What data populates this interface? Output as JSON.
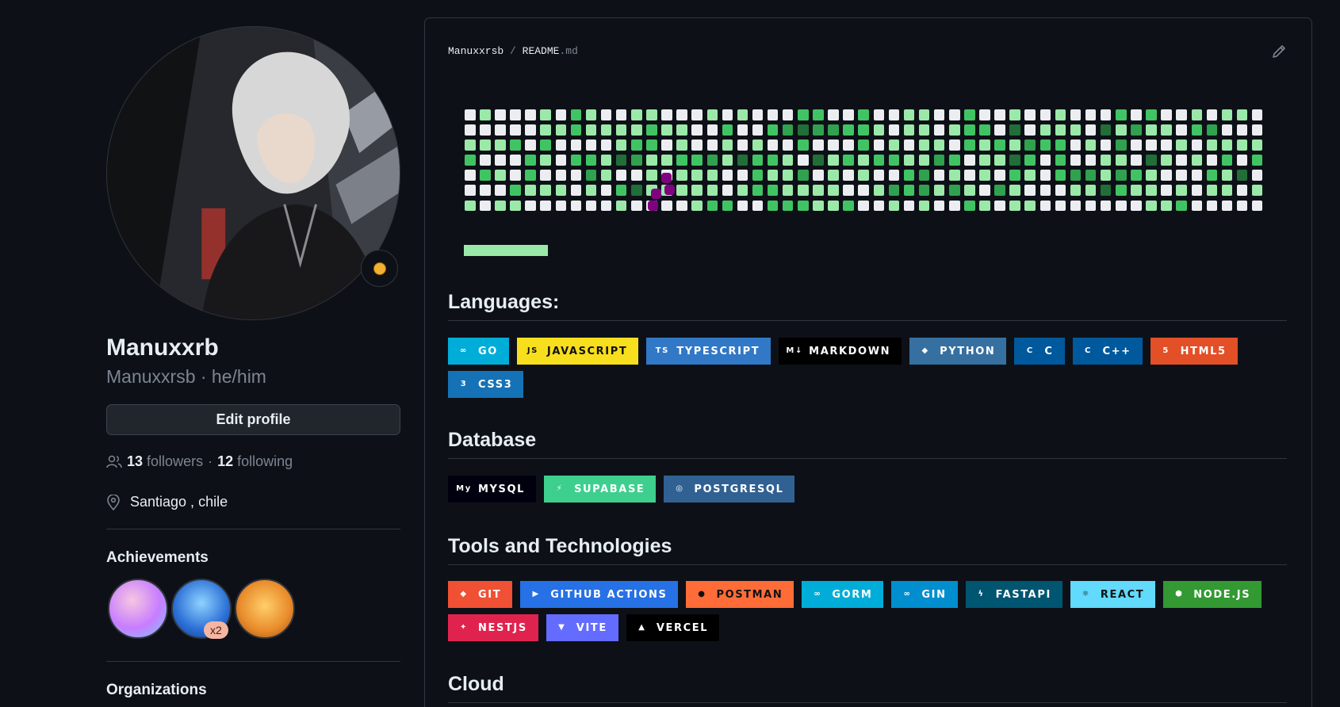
{
  "profile": {
    "name": "Manuxxrb",
    "subtitle": "Manuxxrsb · he/him",
    "edit_label": "Edit profile",
    "followers_count": "13",
    "followers_label": "followers",
    "following_sep": "·",
    "following_count": "12",
    "following_label": "following",
    "location": "Santiago , chile"
  },
  "sections": {
    "achievements": "Achievements",
    "achievement_count": "x2",
    "organizations": "Organizations"
  },
  "readme": {
    "owner": "Manuxxrsb",
    "sep": "/",
    "file_base": "README",
    "file_ext": ".md"
  },
  "headings": {
    "languages": "Languages:",
    "database": "Database",
    "tools": "Tools and Technologies",
    "cloud": "Cloud"
  },
  "languages": [
    {
      "label": "GO",
      "color": "#00add8",
      "icon": "go-icon",
      "glyph": "∞",
      "dark": false
    },
    {
      "label": "JAVASCRIPT",
      "color": "#f7df1e",
      "icon": "javascript-icon",
      "glyph": "JS",
      "dark": true
    },
    {
      "label": "TYPESCRIPT",
      "color": "#3178c6",
      "icon": "typescript-icon",
      "glyph": "TS",
      "dark": false
    },
    {
      "label": "MARKDOWN",
      "color": "#000000",
      "icon": "markdown-icon",
      "glyph": "M↓",
      "dark": false
    },
    {
      "label": "PYTHON",
      "color": "#3670a0",
      "icon": "python-icon",
      "glyph": "◆",
      "dark": false
    },
    {
      "label": "C",
      "color": "#00599c",
      "icon": "c-icon",
      "glyph": "C",
      "dark": false
    },
    {
      "label": "C++",
      "color": "#00599c",
      "icon": "cplusplus-icon",
      "glyph": "C",
      "dark": false
    },
    {
      "label": "HTML5",
      "color": "#e34f26",
      "icon": "html5-icon",
      "glyph": "5",
      "dark": false
    },
    {
      "label": "CSS3",
      "color": "#1572b6",
      "icon": "css3-icon",
      "glyph": "3",
      "dark": false
    }
  ],
  "database": [
    {
      "label": "MYSQL",
      "color": "#00000f",
      "icon": "mysql-icon",
      "glyph": "My",
      "dark": false
    },
    {
      "label": "SUPABASE",
      "color": "#3ecf8e",
      "icon": "supabase-icon",
      "glyph": "⚡",
      "dark": false
    },
    {
      "label": "POSTGRESQL",
      "color": "#316192",
      "icon": "postgresql-icon",
      "glyph": "◎",
      "dark": false
    }
  ],
  "tools": [
    {
      "label": "GIT",
      "color": "#f05033",
      "icon": "git-icon",
      "glyph": "◆",
      "dark": false
    },
    {
      "label": "GITHUB ACTIONS",
      "color": "#2671e5",
      "icon": "github-actions-icon",
      "glyph": "▶",
      "dark": false
    },
    {
      "label": "POSTMAN",
      "color": "#ff6c37",
      "icon": "postman-icon",
      "glyph": "●",
      "dark": true
    },
    {
      "label": "GORM",
      "color": "#00add8",
      "icon": "gorm-icon",
      "glyph": "∞",
      "dark": false
    },
    {
      "label": "GIN",
      "color": "#008ecf",
      "icon": "gin-icon",
      "glyph": "∞",
      "dark": false
    },
    {
      "label": "FASTAPI",
      "color": "#005571",
      "icon": "fastapi-icon",
      "glyph": "ϟ",
      "dark": false
    },
    {
      "label": "REACT",
      "color": "#61dafb",
      "icon": "react-icon",
      "glyph": "⚛",
      "dark": true
    },
    {
      "label": "NODE.JS",
      "color": "#339933",
      "icon": "nodejs-icon",
      "glyph": "⬢",
      "dark": false
    },
    {
      "label": "NESTJS",
      "color": "#e0234e",
      "icon": "nestjs-icon",
      "glyph": "✦",
      "dark": false
    },
    {
      "label": "VITE",
      "color": "#646cff",
      "icon": "vite-icon",
      "glyph": "▼",
      "dark": false
    },
    {
      "label": "VERCEL",
      "color": "#000000",
      "icon": "vercel-icon",
      "glyph": "▲",
      "dark": false
    }
  ],
  "contribution_levels": [
    "#ebedf0",
    "#9be9a8",
    "#40c463",
    "#30a14e",
    "#216e39"
  ],
  "snake_color": "#800080",
  "progress_fraction": 0.1
}
